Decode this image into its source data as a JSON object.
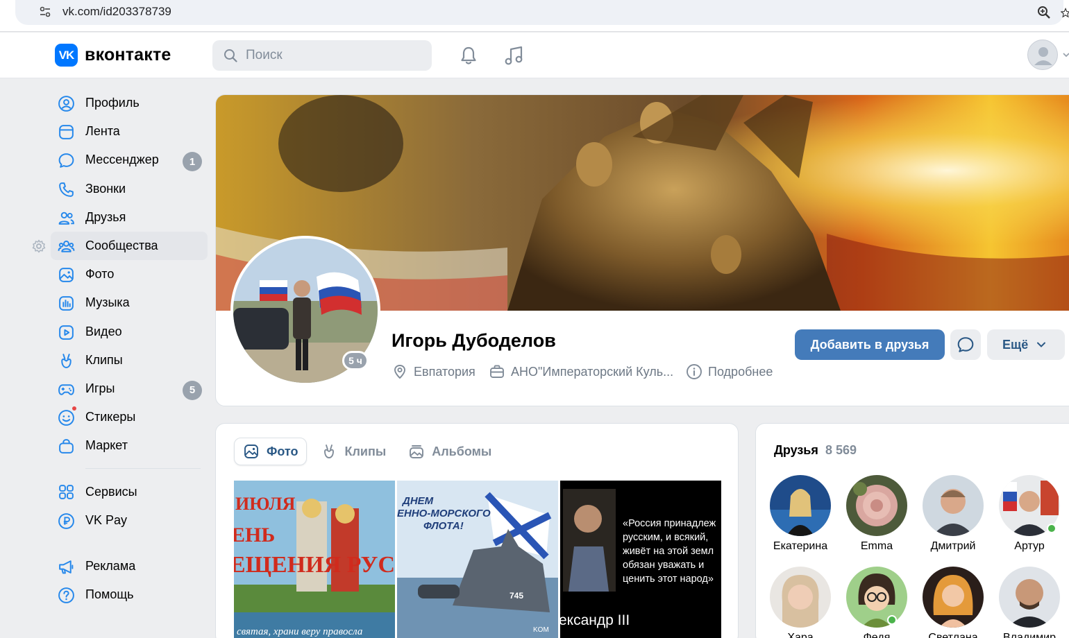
{
  "browser": {
    "url": "vk.com/id203378739"
  },
  "header": {
    "logo_mark": "VK",
    "logo_text": "вконтакте",
    "search_placeholder": "Поиск"
  },
  "nav": {
    "items": [
      {
        "label": "Профиль",
        "icon": "user-circle-icon"
      },
      {
        "label": "Лента",
        "icon": "newsfeed-icon"
      },
      {
        "label": "Мессенджер",
        "icon": "message-icon",
        "badge": "1"
      },
      {
        "label": "Звонки",
        "icon": "phone-icon"
      },
      {
        "label": "Друзья",
        "icon": "friends-icon"
      },
      {
        "label": "Сообщества",
        "icon": "communities-icon"
      },
      {
        "label": "Фото",
        "icon": "photo-icon"
      },
      {
        "label": "Музыка",
        "icon": "music-icon"
      },
      {
        "label": "Видео",
        "icon": "video-icon"
      },
      {
        "label": "Клипы",
        "icon": "clips-icon"
      },
      {
        "label": "Игры",
        "icon": "gamepad-icon",
        "badge": "5"
      },
      {
        "label": "Стикеры",
        "icon": "sticker-icon"
      },
      {
        "label": "Маркет",
        "icon": "market-icon"
      }
    ],
    "services": [
      {
        "label": "Сервисы",
        "icon": "services-icon"
      },
      {
        "label": "VK Pay",
        "icon": "vkpay-icon"
      }
    ],
    "extra": [
      {
        "label": "Реклама",
        "icon": "megaphone-icon"
      },
      {
        "label": "Помощь",
        "icon": "help-icon"
      }
    ]
  },
  "profile": {
    "name": "Игорь Дубоделов",
    "last_seen": "5 ч",
    "city": "Евпатория",
    "work": "АНО\"Императорский Куль...",
    "more_info": "Подробнее",
    "add_friend": "Добавить в друзья",
    "more_button": "Ещё"
  },
  "photos": {
    "tabs": [
      "Фото",
      "Клипы",
      "Альбомы"
    ],
    "photo1": {
      "line1": "ИЮЛЯ",
      "line2": "ЕНЬ",
      "line3": "ЕЩЕНИЯ РУСИ",
      "caption": "святая, храни веру правосла"
    },
    "photo2": {
      "line1": "ДНЕМ",
      "line2": "ЕННО-МОРСКОГО",
      "line3": "ФЛОТА!",
      "ship_number": "745",
      "mark": "KOM"
    },
    "photo3": {
      "quote": [
        "«Россия принадлеж",
        "русским, и всякий,",
        "живёт на этой земл",
        "обязан уважать и",
        "ценить этот народ»"
      ],
      "caption": "ександр III"
    }
  },
  "friends": {
    "title": "Друзья",
    "count": "8 569",
    "list": [
      {
        "name": "Екатерина"
      },
      {
        "name": "Emma"
      },
      {
        "name": "Дмитрий"
      },
      {
        "name": "Артур"
      },
      {
        "name": "Хара"
      },
      {
        "name": "Федя"
      },
      {
        "name": "Светлана"
      },
      {
        "name": "Владимир"
      }
    ]
  },
  "colors": {
    "accent": "#447bba",
    "link": "#2a5885",
    "muted": "#818c99",
    "badge": "#99a2ad",
    "online": "#4bb34b",
    "background": "#edeef0"
  }
}
